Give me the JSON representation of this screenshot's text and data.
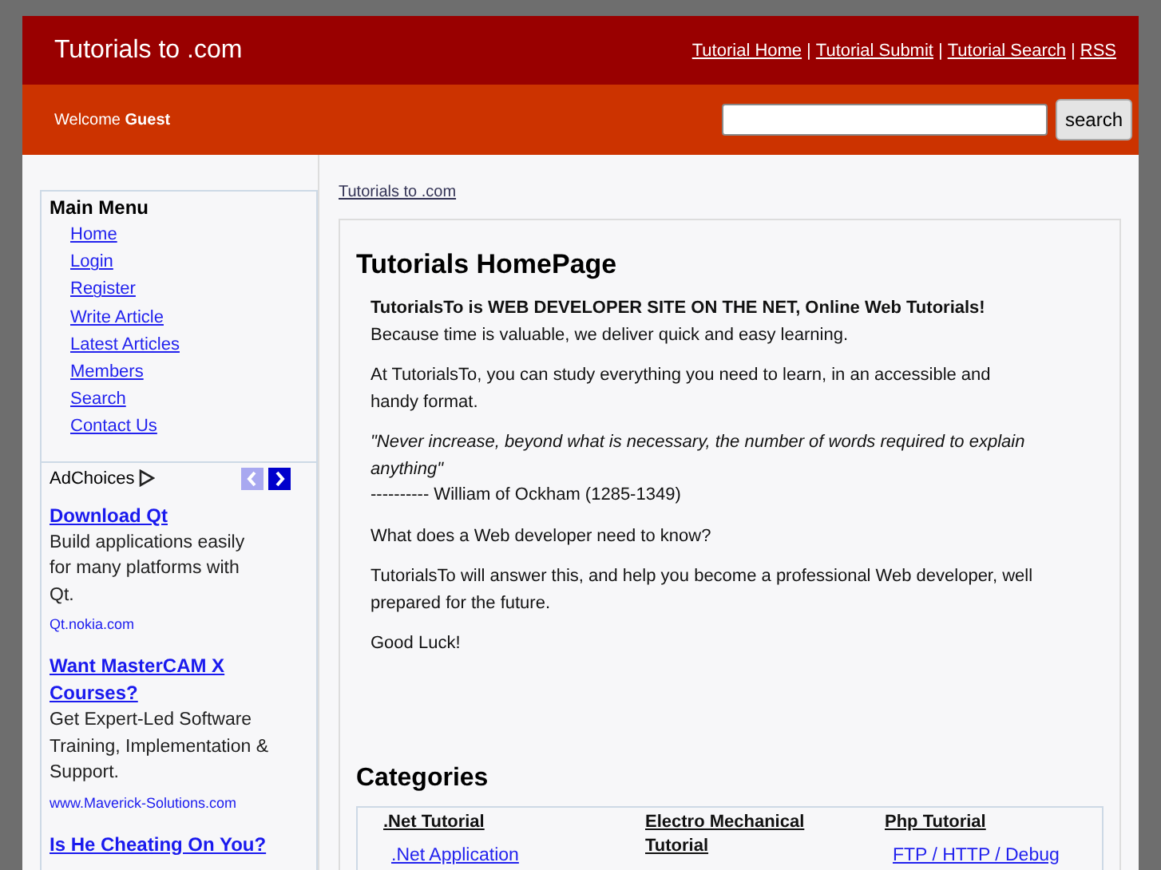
{
  "header": {
    "site_title": "Tutorials to .com",
    "nav_links": [
      "Tutorial Home",
      "Tutorial Submit",
      "Tutorial Search",
      "RSS"
    ],
    "nav_separator": "|"
  },
  "subheader": {
    "welcome": "Welcome",
    "user": "Guest",
    "search": {
      "button": "search"
    }
  },
  "sidebar": {
    "menu_title": "Main Menu",
    "menu_items": [
      "Home",
      "Login",
      "Register",
      "Write Article",
      "Latest Articles",
      "Members",
      "Search",
      "Contact Us"
    ],
    "adchoices": {
      "label": "AdChoices",
      "prev_disabled": true,
      "next_disabled": false
    },
    "ads": [
      {
        "title": "Download Qt",
        "text": "Build applications easily for many platforms with Qt.",
        "url": "Qt.nokia.com"
      },
      {
        "title": "Want MasterCAM X Courses?",
        "text": "Get Expert-Led Software Training, Implementation & Support.",
        "url": "www.Maverick-Solutions.com"
      },
      {
        "title": "Is He Cheating On You?"
      }
    ]
  },
  "breadcrumb": "Tutorials to .com",
  "main": {
    "title": "Tutorials HomePage",
    "paragraphs": [
      {
        "kind": "lead",
        "lines": [
          "TutorialsTo is WEB DEVELOPER SITE ON THE NET, Online Web Tutorials!",
          "Because time is valuable, we deliver quick and easy learning."
        ]
      },
      {
        "kind": "plain",
        "lines": [
          "At TutorialsTo, you can study everything you need to learn, in an accessible and handy format."
        ]
      },
      {
        "kind": "quote",
        "lines": [
          "\"Never increase, beyond what is necessary, the number of words required to explain anything\"",
          "---------- William of Ockham (1285-1349)"
        ]
      },
      {
        "kind": "plain",
        "lines": [
          "What does a Web developer need to know?"
        ]
      },
      {
        "kind": "plain",
        "lines": [
          "TutorialsTo will answer this, and help you become a professional Web developer, well prepared for the future."
        ]
      },
      {
        "kind": "plain",
        "lines": [
          "Good Luck!"
        ]
      }
    ],
    "categories_title": "Categories",
    "categories": [
      {
        "heading": ".Net Tutorial",
        "links": [
          ".Net Application"
        ]
      },
      {
        "heading": "Electro Mechanical Tutorial"
      },
      {
        "heading": "Php Tutorial",
        "links": [
          "FTP / HTTP / Debug"
        ]
      }
    ]
  }
}
